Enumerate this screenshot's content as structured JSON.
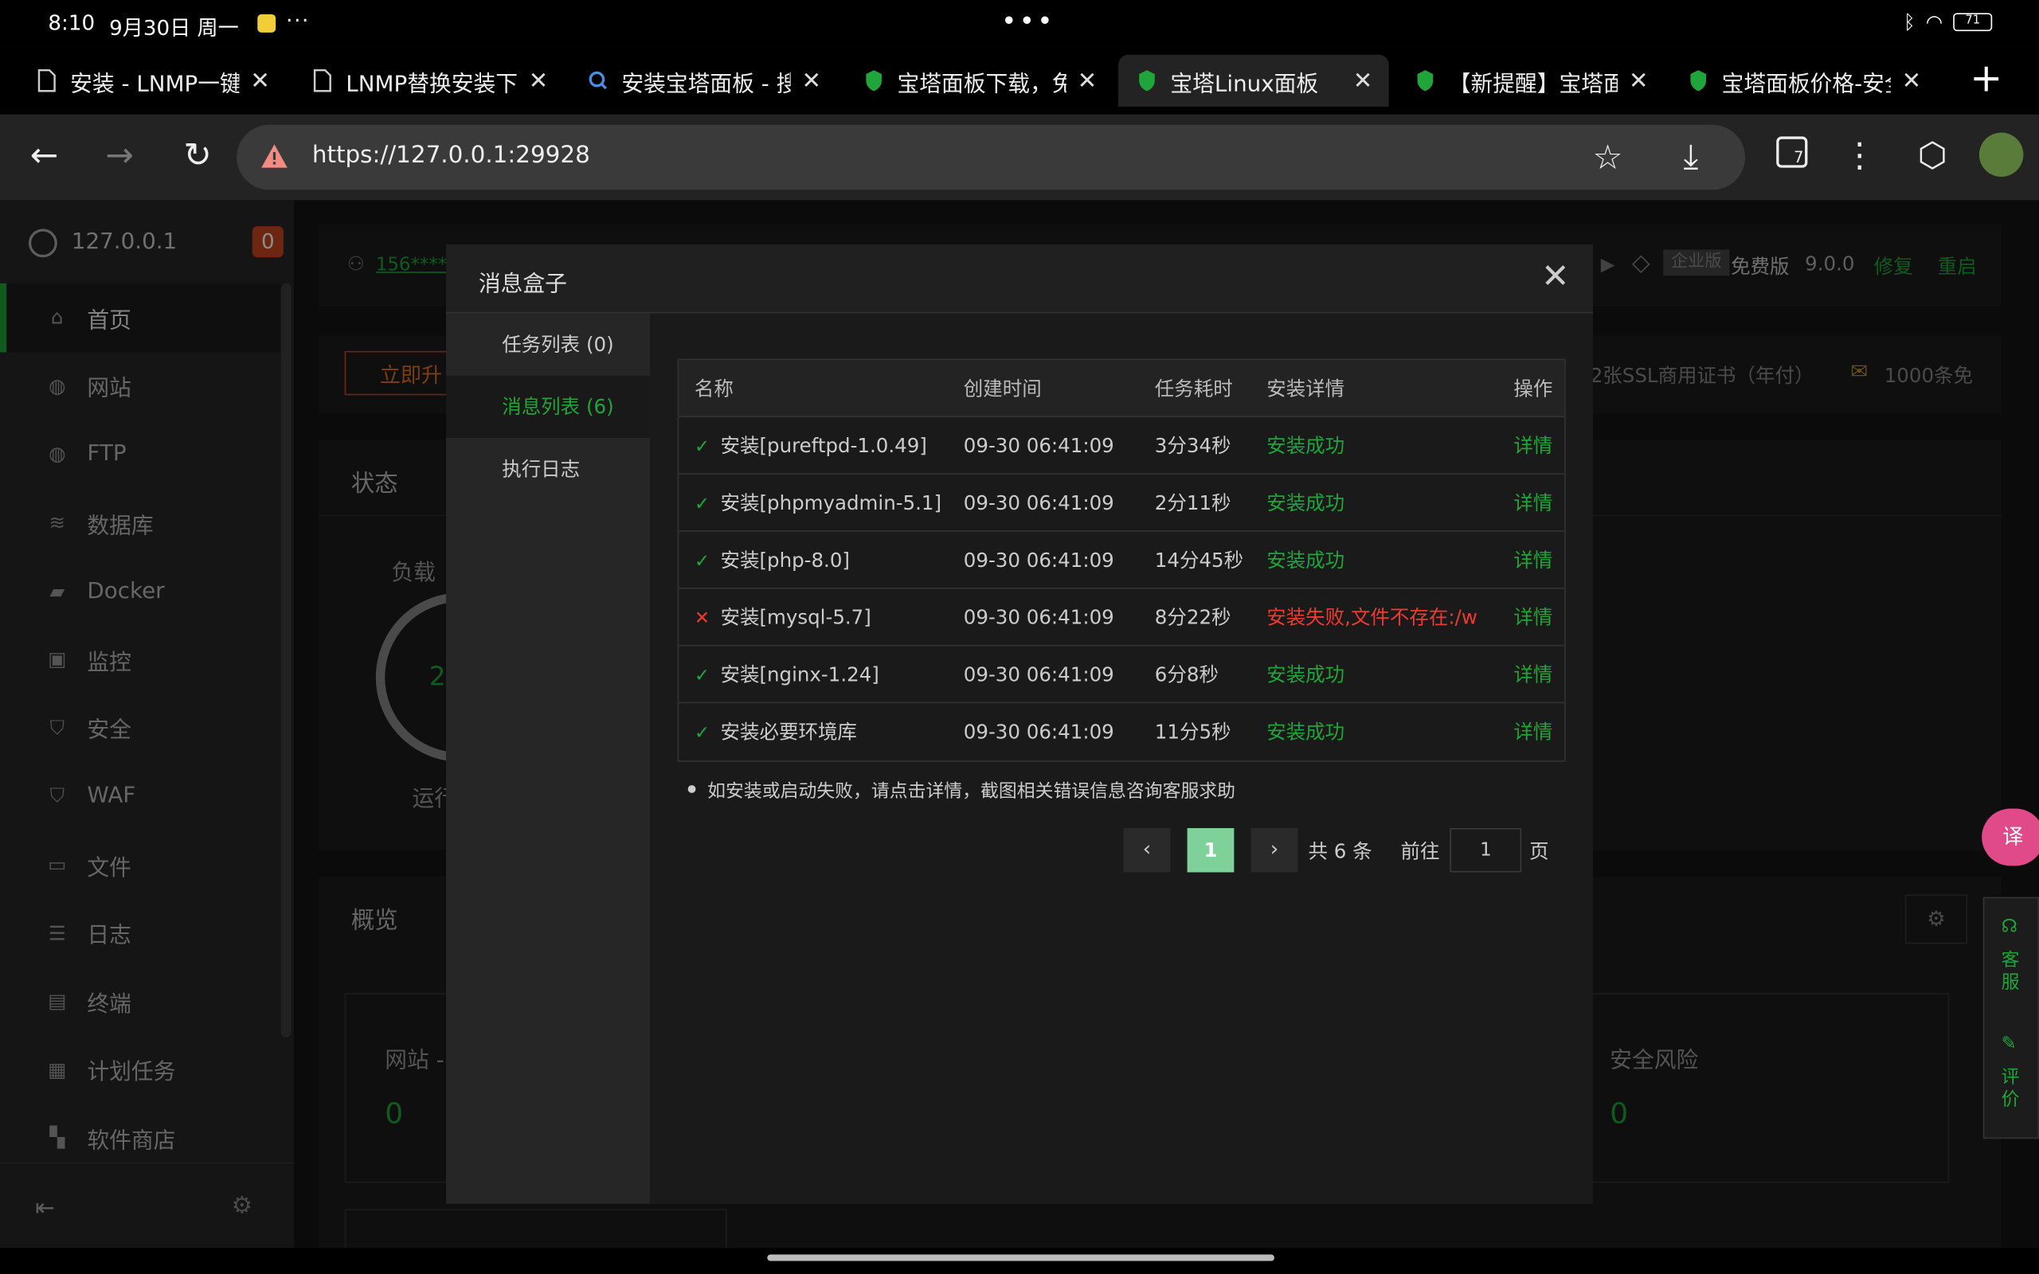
{
  "status": {
    "time": "8:10",
    "date": "9月30日 周一",
    "more": "···",
    "battery": "71"
  },
  "tabs": [
    {
      "title": "安装 - LNMP一键",
      "icon": "page-icon"
    },
    {
      "title": "LNMP替换安装下",
      "icon": "page-icon"
    },
    {
      "title": "安装宝塔面板 - 搜",
      "icon": "search-icon"
    },
    {
      "title": "宝塔面板下载，免",
      "icon": "bt-shield-icon"
    },
    {
      "title": "宝塔Linux面板",
      "icon": "bt-shield-icon"
    },
    {
      "title": "【新提醒】宝塔面",
      "icon": "bt-shield-icon"
    },
    {
      "title": "宝塔面板价格-安全",
      "icon": "bt-shield-icon"
    }
  ],
  "address": {
    "url": "https://127.0.0.1:29928",
    "tab_count": "7"
  },
  "sidebar": {
    "host": "127.0.0.1",
    "badge": "0",
    "items": [
      {
        "label": "首页",
        "icon": "home-icon"
      },
      {
        "label": "网站",
        "icon": "globe-icon"
      },
      {
        "label": "FTP",
        "icon": "ftp-icon"
      },
      {
        "label": "数据库",
        "icon": "database-icon"
      },
      {
        "label": "Docker",
        "icon": "docker-icon"
      },
      {
        "label": "监控",
        "icon": "monitor-icon"
      },
      {
        "label": "安全",
        "icon": "shield-icon"
      },
      {
        "label": "WAF",
        "icon": "waf-icon"
      },
      {
        "label": "文件",
        "icon": "folder-icon"
      },
      {
        "label": "日志",
        "icon": "log-icon"
      },
      {
        "label": "终端",
        "icon": "terminal-icon"
      },
      {
        "label": "计划任务",
        "icon": "calendar-icon"
      },
      {
        "label": "软件商店",
        "icon": "apps-icon"
      }
    ]
  },
  "header": {
    "user": "156****",
    "edition": "企业版",
    "free": "免费版",
    "version": "9.0.0",
    "repair": "修复",
    "restart": "重启",
    "upgrade": "立即升",
    "ssl_promo": "2张SSL商用证书（年付）",
    "sms_promo": "1000条免"
  },
  "sections": {
    "status_title": "状态",
    "load_label": "负载",
    "load_value": "2",
    "run_label": "运行",
    "overview_title": "概览",
    "site_label": "网站 -",
    "site_value": "0",
    "risk_label": "安全风险",
    "risk_value": "0"
  },
  "dialog": {
    "title": "消息盒子",
    "nav": [
      {
        "label": "任务列表 (0)"
      },
      {
        "label": "消息列表 (6)"
      },
      {
        "label": "执行日志"
      }
    ],
    "columns": [
      "名称",
      "创建时间",
      "任务耗时",
      "安装详情",
      "操作"
    ],
    "rows": [
      {
        "name": "安装[pureftpd-1.0.49]",
        "time": "09-30 06:41:09",
        "duration": "3分34秒",
        "result": "安装成功",
        "action": "详情",
        "ok": true
      },
      {
        "name": "安装[phpmyadmin-5.1]",
        "time": "09-30 06:41:09",
        "duration": "2分11秒",
        "result": "安装成功",
        "action": "详情",
        "ok": true
      },
      {
        "name": "安装[php-8.0]",
        "time": "09-30 06:41:09",
        "duration": "14分45秒",
        "result": "安装成功",
        "action": "详情",
        "ok": true
      },
      {
        "name": "安装[mysql-5.7]",
        "time": "09-30 06:41:09",
        "duration": "8分22秒",
        "result": "安装失败,文件不存在:/ww",
        "action": "详情",
        "ok": false
      },
      {
        "name": "安装[nginx-1.24]",
        "time": "09-30 06:41:09",
        "duration": "6分8秒",
        "result": "安装成功",
        "action": "详情",
        "ok": true
      },
      {
        "name": "安装必要环境库",
        "time": "09-30 06:41:09",
        "duration": "11分5秒",
        "result": "安装成功",
        "action": "详情",
        "ok": true
      }
    ],
    "tip": "如安装或启动失败，请点击详情，截图相关错误信息咨询客服求助",
    "pager": {
      "current": "1",
      "total": "共 6 条",
      "goto": "前往",
      "goto_value": "1",
      "page_unit": "页"
    }
  },
  "float": {
    "service": "客服",
    "review": "评价",
    "translate": "译"
  },
  "colors": {
    "accent": "#20a53a",
    "danger": "#ef3a30",
    "badge": "#c6471e"
  }
}
